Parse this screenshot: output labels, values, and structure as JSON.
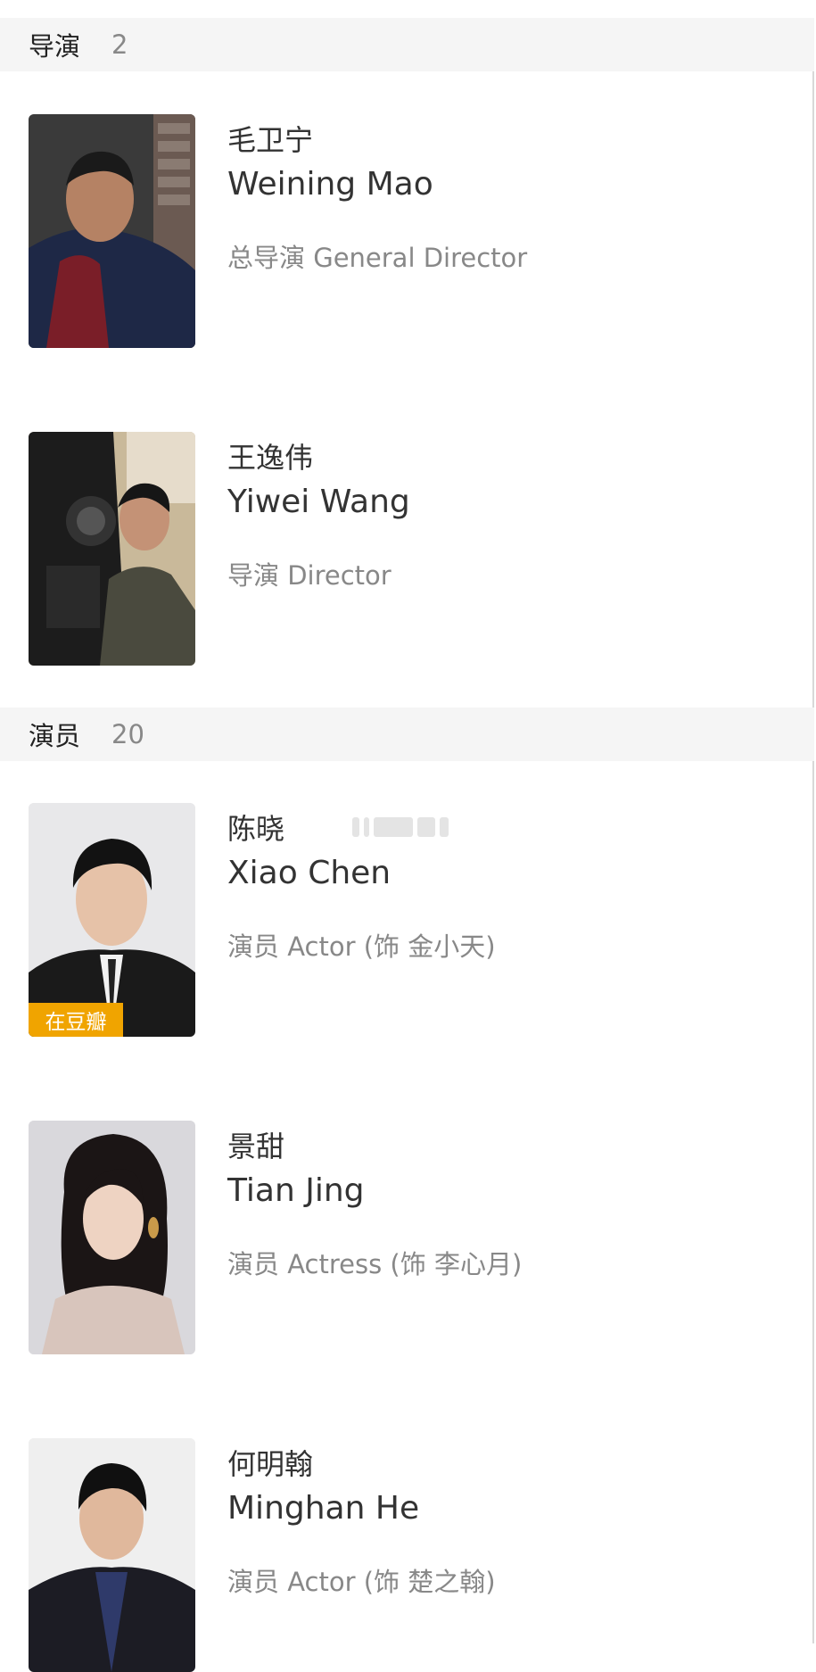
{
  "sections": [
    {
      "title": "导演",
      "count": "2"
    },
    {
      "title": "演员",
      "count": "20"
    }
  ],
  "directors": [
    {
      "name_cn": "毛卫宁",
      "name_en": "Weining Mao",
      "role": "总导演 General Director"
    },
    {
      "name_cn": "王逸伟",
      "name_en": "Yiwei Wang",
      "role": "导演 Director"
    }
  ],
  "actors": [
    {
      "name_cn": "陈晓",
      "name_en": "Xiao Chen",
      "role": "演员 Actor (饰 金小天)",
      "tag": "在豆瓣"
    },
    {
      "name_cn": "景甜",
      "name_en": "Tian Jing",
      "role": "演员 Actress (饰 李心月)"
    },
    {
      "name_cn": "何明翰",
      "name_en": "Minghan He",
      "role": "演员 Actor (饰 楚之翰)"
    }
  ],
  "colors": {
    "header_bg": "#f5f5f5",
    "text_primary": "#333333",
    "text_secondary": "#888888",
    "douban_tag": "#f0a400"
  }
}
